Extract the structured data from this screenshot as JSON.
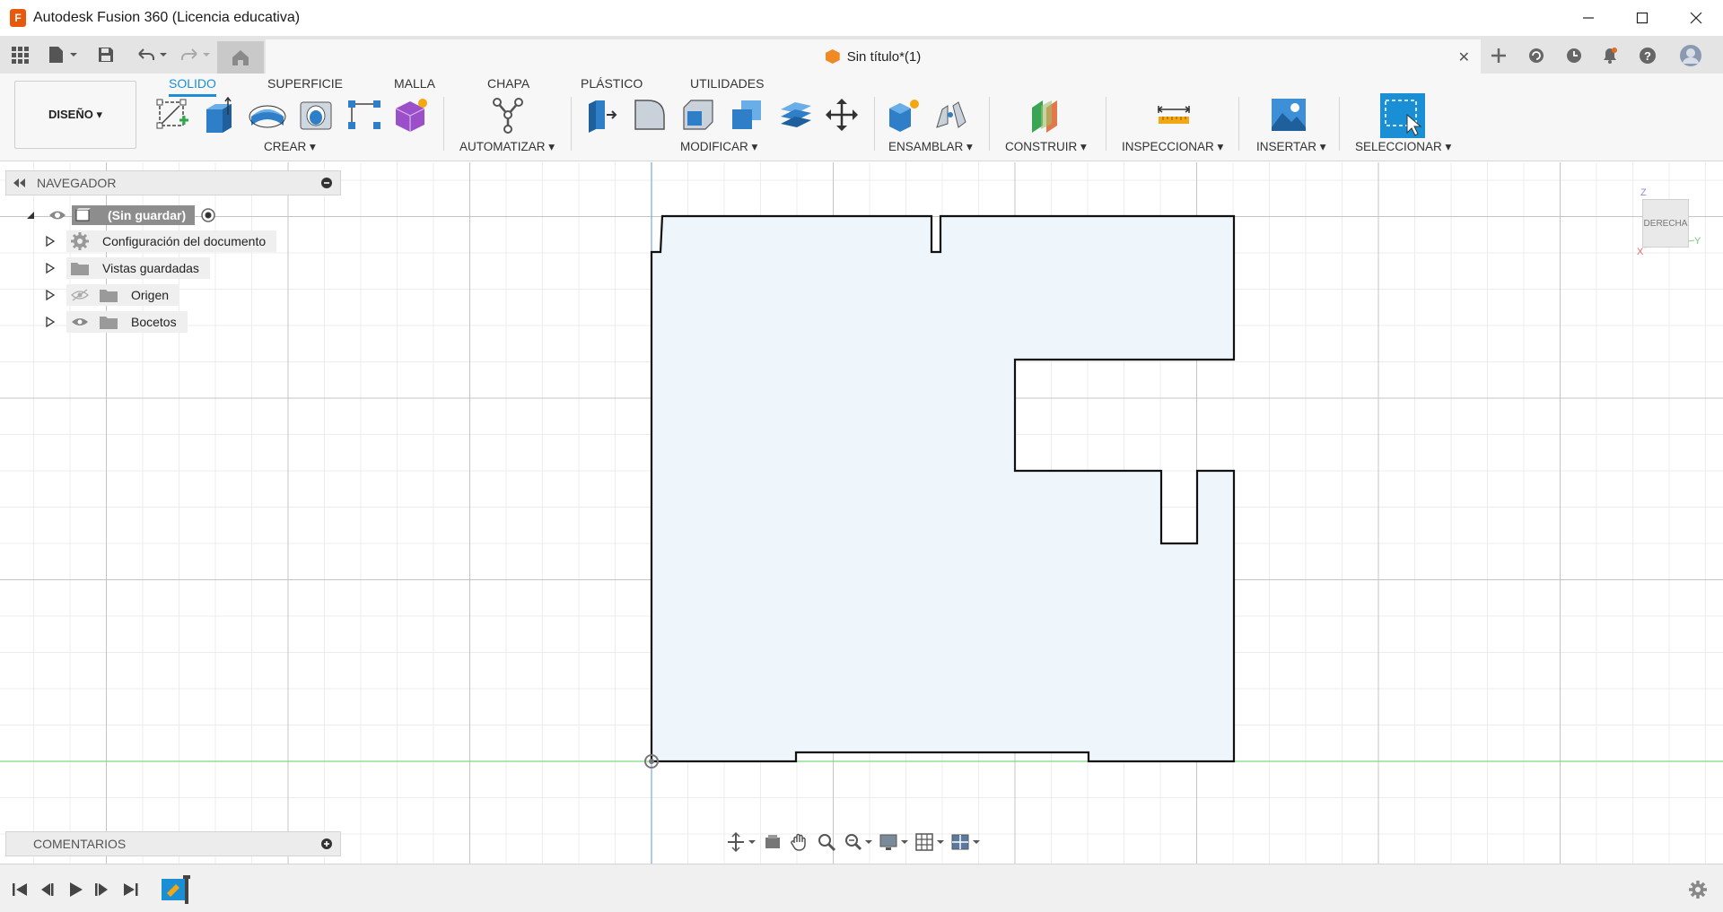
{
  "window": {
    "title": "Autodesk Fusion 360 (Licencia educativa)",
    "logo_letter": "F",
    "minimize": "—",
    "maximize": "☐",
    "close": "✕"
  },
  "document": {
    "tab_title": "Sin título*(1)",
    "close": "✕"
  },
  "workspace": {
    "label": "DISEÑO ▾"
  },
  "tabs": [
    {
      "label": "SOLIDO",
      "active": true
    },
    {
      "label": "SUPERFICIE",
      "active": false
    },
    {
      "label": "MALLA",
      "active": false
    },
    {
      "label": "CHAPA",
      "active": false
    },
    {
      "label": "PLÁSTICO",
      "active": false
    },
    {
      "label": "UTILIDADES",
      "active": false
    }
  ],
  "groups": {
    "crear": "CREAR ▾",
    "automatizar": "AUTOMATIZAR ▾",
    "modificar": "MODIFICAR ▾",
    "ensamblar": "ENSAMBLAR ▾",
    "construir": "CONSTRUIR ▾",
    "inspeccionar": "INSPECCIONAR ▾",
    "insertar": "INSERTAR ▾",
    "seleccionar": "SELECCIONAR ▾"
  },
  "navigator": {
    "title": "NAVEGADOR",
    "root": "(Sin guardar)",
    "items": [
      {
        "label": "Configuración del documento",
        "icon": "gear-icon"
      },
      {
        "label": "Vistas guardadas",
        "icon": "folder-icon"
      },
      {
        "label": "Origen",
        "icon": "folder-icon"
      },
      {
        "label": "Bocetos",
        "icon": "folder-icon"
      }
    ]
  },
  "comments": {
    "title": "COMENTARIOS"
  },
  "viewcube": {
    "face": "DERECHA",
    "axis_z": "Z",
    "axis_y": "Y",
    "axis_x": "X"
  },
  "colors": {
    "accent": "#1b8fd6",
    "sketch_fill": "#eef6fc",
    "sketch_line": "#111111",
    "grid": "#d8d8d8",
    "axis_green": "#7fd97f",
    "axis_blue": "#7aa7e0"
  }
}
